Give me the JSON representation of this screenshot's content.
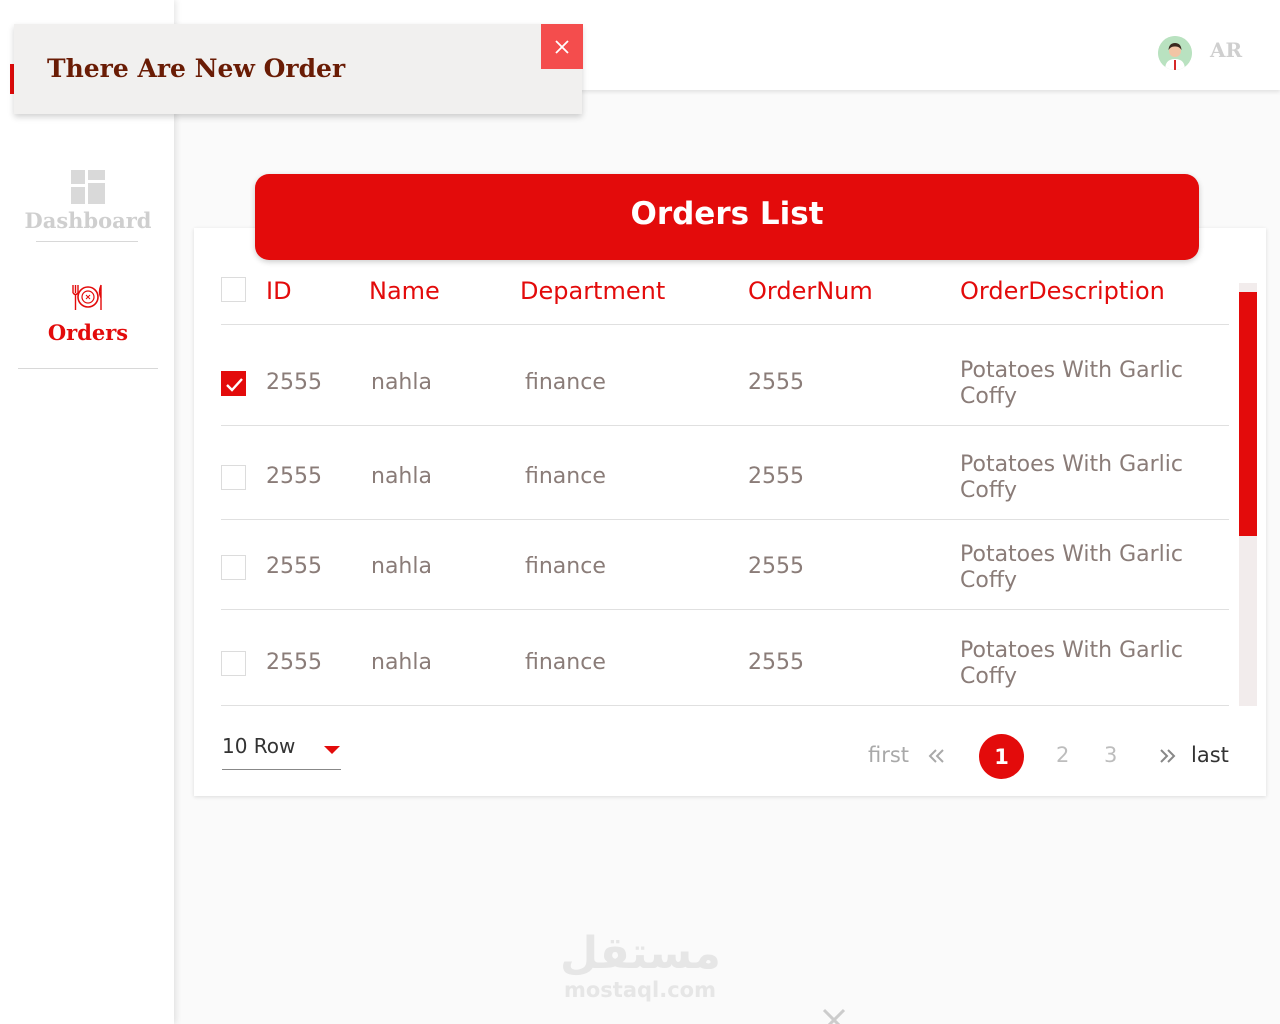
{
  "notification": {
    "message": "There Are New Order",
    "close_label": "X"
  },
  "header": {
    "language": "AR"
  },
  "sidebar": {
    "items": [
      {
        "label": "Dashboard",
        "icon": "dashboard-grid-icon"
      },
      {
        "label": "Orders",
        "icon": "plate-cutlery-icon"
      }
    ]
  },
  "orders": {
    "title": "Orders List",
    "columns": [
      "ID",
      "Name",
      "Department",
      "OrderNum",
      "OrderDescription"
    ],
    "rows": [
      {
        "checked": true,
        "id": "2555",
        "name": "nahla",
        "department": "finance",
        "order_num": "2555",
        "description": "Potatoes With Garlic Coffy"
      },
      {
        "checked": false,
        "id": "2555",
        "name": "nahla",
        "department": "finance",
        "order_num": "2555",
        "description": "Potatoes With Garlic Coffy"
      },
      {
        "checked": false,
        "id": "2555",
        "name": "nahla",
        "department": "finance",
        "order_num": "2555",
        "description": "Potatoes With Garlic Coffy"
      },
      {
        "checked": false,
        "id": "2555",
        "name": "nahla",
        "department": "finance",
        "order_num": "2555",
        "description": "Potatoes With Garlic Coffy"
      }
    ]
  },
  "pagination": {
    "rows_per_page": "10 Row",
    "first_label": "first",
    "last_label": "last",
    "current_page": "1",
    "other_pages": [
      "2",
      "3"
    ]
  },
  "watermark": {
    "arabic": "مستقل",
    "latin": "mostaql.com"
  },
  "colors": {
    "accent": "#e30b0b",
    "toast_bg": "#f1f0ef",
    "toast_text": "#6a1c05",
    "muted_text": "#8a7c78"
  }
}
